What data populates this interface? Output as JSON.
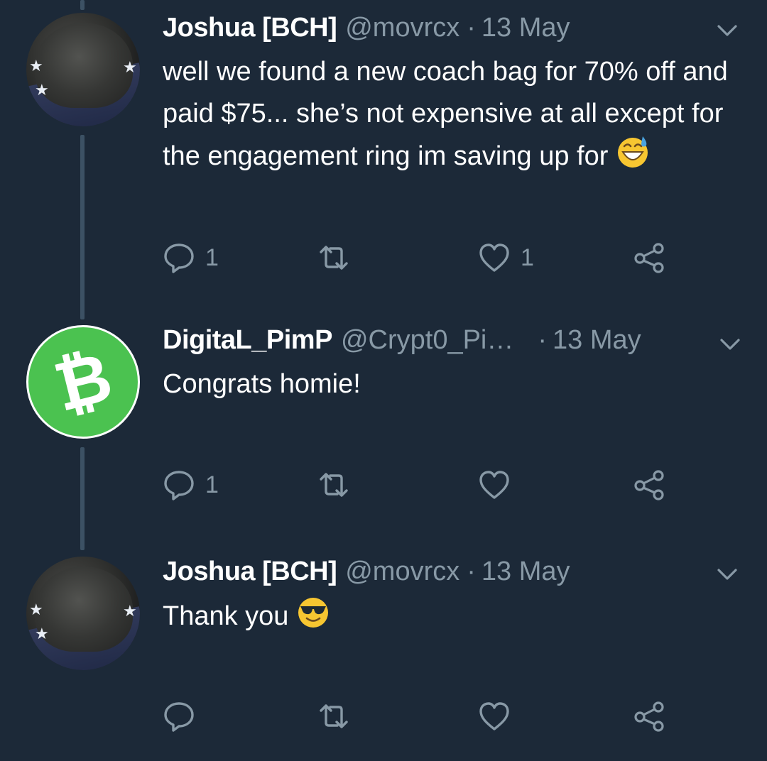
{
  "tweets": [
    {
      "name": "Joshua [BCH]",
      "handle": "@movrcx",
      "separator": "·",
      "date": "13 May",
      "text": "well we found a new coach bag for 70% off and paid $75... she’s not expensive at all except for the engagement ring im saving up for",
      "emoji": "grinning-face-with-sweat",
      "avatar": "camo-cap",
      "reply_count": "1",
      "retweet_count": "",
      "like_count": "1"
    },
    {
      "name": "DigitaL_PimP",
      "handle": "@Crypt0_Pi…",
      "separator": "·",
      "date": "13 May",
      "text": "Congrats homie!",
      "avatar": "bitcoin-cash-logo",
      "reply_count": "1",
      "retweet_count": "",
      "like_count": ""
    },
    {
      "name": "Joshua [BCH]",
      "handle": "@movrcx",
      "separator": "·",
      "date": "13 May",
      "text": "Thank you",
      "emoji": "smiling-face-with-sunglasses",
      "avatar": "camo-cap",
      "reply_count": "",
      "retweet_count": "",
      "like_count": ""
    }
  ],
  "icons": {
    "reply": "reply-icon",
    "retweet": "retweet-icon",
    "like": "heart-icon",
    "share": "share-icon",
    "menu": "chevron-down-icon"
  },
  "colors": {
    "background": "#1c2938",
    "secondary_text": "#8899a6",
    "thread_line": "#3c5164",
    "btc_green": "#4bc250"
  }
}
